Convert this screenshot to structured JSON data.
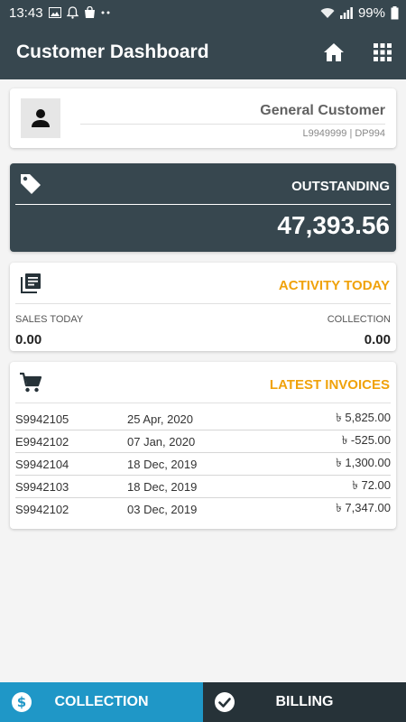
{
  "status_bar": {
    "time": "13:43",
    "battery": "99%"
  },
  "app_bar": {
    "title": "Customer Dashboard",
    "icons": [
      "home-icon",
      "grid-apps-icon"
    ]
  },
  "customer": {
    "name": "General Customer",
    "codes": "L9949999 | DP994",
    "icon": "person-icon"
  },
  "outstanding": {
    "label": "OUTSTANDING",
    "value": "47,393.56",
    "icon": "tag-icon"
  },
  "activity": {
    "title": "ACTIVITY TODAY",
    "icon": "book-list-icon",
    "sales_label": "SALES TODAY",
    "sales_value": "0.00",
    "collection_label": "COLLECTION",
    "collection_value": "0.00"
  },
  "invoices": {
    "title": "LATEST INVOICES",
    "icon": "cart-icon",
    "rows": [
      {
        "no": "S9942105",
        "date": "25 Apr, 2020",
        "amount": "৳ 5,825.00"
      },
      {
        "no": "E9942102",
        "date": "07 Jan, 2020",
        "amount": "৳ -525.00"
      },
      {
        "no": "S9942104",
        "date": "18 Dec, 2019",
        "amount": "৳ 1,300.00"
      },
      {
        "no": "S9942103",
        "date": "18 Dec, 2019",
        "amount": "৳ 72.00"
      },
      {
        "no": "S9942102",
        "date": "03 Dec, 2019",
        "amount": "৳ 7,347.00"
      }
    ]
  },
  "bottom_nav": {
    "collection_label": "COLLECTION",
    "billing_label": "BILLING"
  },
  "colors": {
    "primary_dark": "#37474f",
    "accent_orange": "#f0a20b",
    "collection_blue": "#1f97c7",
    "billing_dark": "#263238"
  }
}
